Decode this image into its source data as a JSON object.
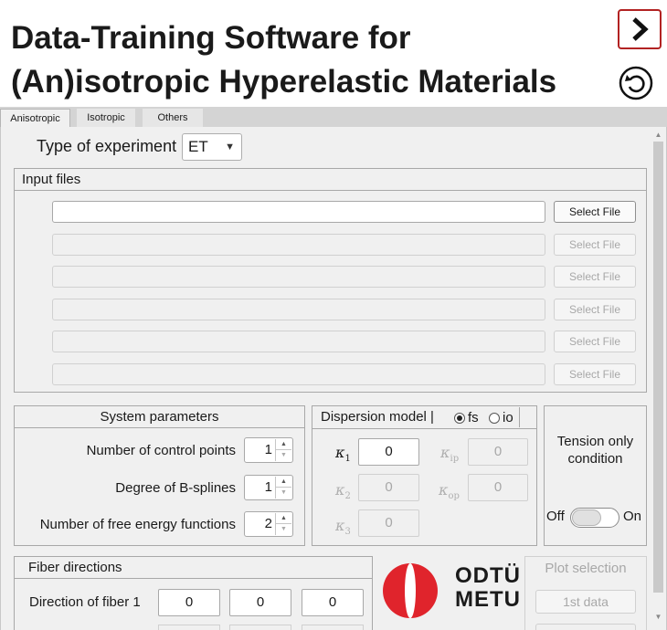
{
  "header": {
    "title_line1": "Data-Training Software for",
    "title_line2": "(An)isotropic Hyperelastic Materials"
  },
  "tabs": [
    {
      "label": "Anisotropic",
      "active": true
    },
    {
      "label": "Isotropic",
      "active": false
    },
    {
      "label": "Others",
      "active": false
    }
  ],
  "experiment": {
    "label": "Type of experiment",
    "selected": "ET"
  },
  "input_files": {
    "title": "Input files",
    "button_label": "Select File",
    "rows": [
      {
        "value": "",
        "enabled": true
      },
      {
        "value": "",
        "enabled": false
      },
      {
        "value": "",
        "enabled": false
      },
      {
        "value": "",
        "enabled": false
      },
      {
        "value": "",
        "enabled": false
      },
      {
        "value": "",
        "enabled": false
      }
    ]
  },
  "system_parameters": {
    "title": "System parameters",
    "control_points": {
      "label": "Number of control points",
      "value": "1"
    },
    "bspline_degree": {
      "label": "Degree of B-splines",
      "value": "1"
    },
    "free_energy_functions": {
      "label": "Number of free energy functions",
      "value": "2"
    }
  },
  "dispersion_model": {
    "title": "Dispersion model |",
    "options": [
      {
        "label": "fs",
        "selected": true
      },
      {
        "label": "io",
        "selected": false
      }
    ],
    "k1": {
      "symbol": "κ",
      "sub": "1",
      "value": "0"
    },
    "k2": {
      "symbol": "κ",
      "sub": "2",
      "value": "0"
    },
    "k3": {
      "symbol": "κ",
      "sub": "3",
      "value": "0"
    },
    "kip": {
      "symbol": "κ",
      "sub": "ip",
      "value": "0"
    },
    "kop": {
      "symbol": "κ",
      "sub": "op",
      "value": "0"
    }
  },
  "tension": {
    "label_line1": "Tension only",
    "label_line2": "condition",
    "off_label": "Off",
    "on_label": "On",
    "state": "Off"
  },
  "fiber_directions": {
    "title": "Fiber directions",
    "fiber1_label": "Direction of fiber 1",
    "fiber1": [
      "0",
      "0",
      "0"
    ]
  },
  "logo": {
    "line1": "ODTÜ",
    "line2": "METU",
    "color": "#e0242c"
  },
  "plot_selection": {
    "title": "Plot selection",
    "first_button": "1st data"
  },
  "colors": {
    "accent_red": "#b22222",
    "background": "#f0f0f0"
  }
}
